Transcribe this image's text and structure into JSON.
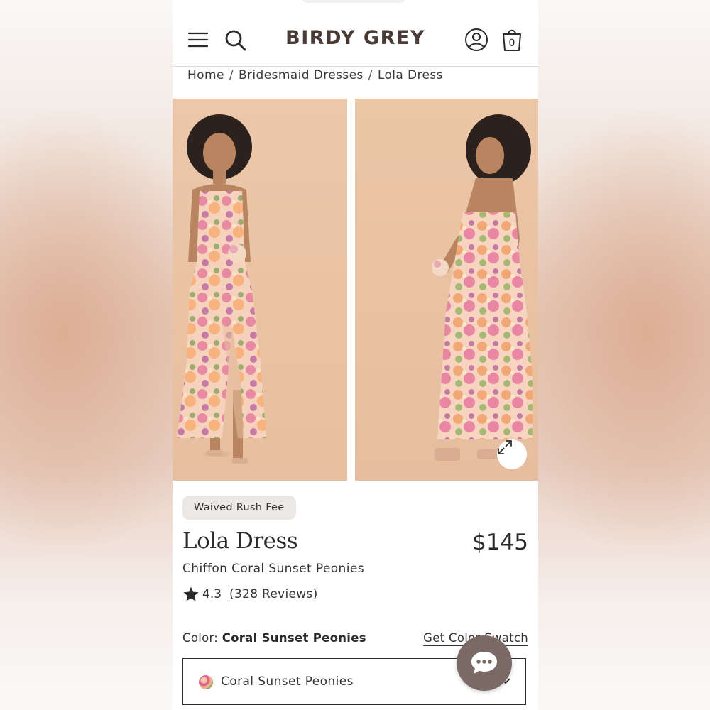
{
  "brand": {
    "logo_text": "BIRDY GREY"
  },
  "header": {
    "menu_icon": "hamburger-menu-icon",
    "search_icon": "search-icon",
    "account_icon": "account-icon",
    "bag_icon": "shopping-bag-icon",
    "bag_count": "0"
  },
  "breadcrumb": {
    "items": [
      "Home",
      "Bridesmaid Dresses",
      "Lola Dress"
    ],
    "separator": "/"
  },
  "gallery": {
    "images": [
      "front-view-photo",
      "back-view-photo"
    ],
    "expand_icon": "expand-icon"
  },
  "product": {
    "badge": "Waived Rush Fee",
    "title": "Lola Dress",
    "price": "$145",
    "subtitle": "Chiffon Coral Sunset Peonies",
    "rating": "4.3",
    "reviews_label": "(328 Reviews)",
    "color_label": "Color:",
    "color_value": "Coral Sunset Peonies",
    "swatch_link": "Get Color Swatch",
    "selected_option": "Coral Sunset Peonies"
  },
  "chat": {
    "icon": "chat-bubble-icon"
  },
  "colors": {
    "text": "#2b2b2b",
    "logo": "#4a3b36",
    "badge_bg": "#ece8e6",
    "photo_bg": "#eac5a6",
    "chat_bg": "#7b6965"
  }
}
